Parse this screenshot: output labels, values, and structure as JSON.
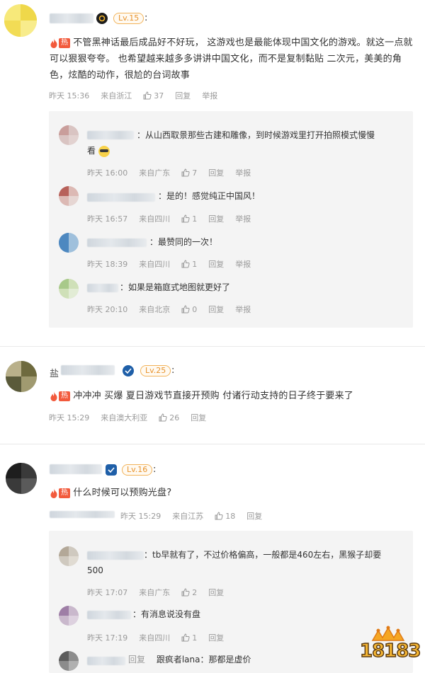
{
  "comments": [
    {
      "level": "Lv.15",
      "hot_tag": "热",
      "text_line1": "不管黑神话最后成品好不好玩， 这游戏也是最能体现中国文化的游戏。就这一点就",
      "text_line2": "可以狠狠夸夸。 也希望越来越多多讲讲中国文化，而不是复制黏贴 二次元，美美的角",
      "text_line3": "色，炫酷的动作，很尬的台词故事",
      "time": "昨天 15:36",
      "location": "来自浙江",
      "likes": "37",
      "reply_label": "回复",
      "report_label": "举报",
      "replies": [
        {
          "text_line1": "：从山西取景那些古建和雕像，到时候游戏里打开拍照模式慢慢",
          "text_line2": "看",
          "time": "昨天 16:00",
          "location": "来自广东",
          "likes": "7",
          "reply_label": "回复",
          "report_label": "举报"
        },
        {
          "text_line1": "：是的！感觉纯正中国风！",
          "time": "昨天 16:57",
          "location": "来自四川",
          "likes": "1",
          "reply_label": "回复",
          "report_label": "举报"
        },
        {
          "text_line1": "：最赞同的一次！",
          "time": "昨天 18:39",
          "location": "来自四川",
          "likes": "1",
          "reply_label": "回复",
          "report_label": "举报"
        },
        {
          "text_line1": "：如果是箱庭式地图就更好了",
          "time": "昨天 20:10",
          "location": "来自北京",
          "likes": "0",
          "reply_label": "回复",
          "report_label": "举报"
        }
      ]
    },
    {
      "name_prefix": "盐",
      "level": "Lv.25",
      "hot_tag": "热",
      "text_line1": "冲冲冲 买爆 夏日游戏节直接开预购 付诸行动支持的日子终于要来了",
      "time": "昨天 15:29",
      "location": "来自澳大利亚",
      "likes": "26",
      "reply_label": "回复"
    },
    {
      "level": "Lv.16",
      "hot_tag": "热",
      "text_line1": "什么时候可以预购光盘?",
      "time": "昨天 15:29",
      "location": "来自江苏",
      "likes": "18",
      "reply_label": "回复",
      "replies": [
        {
          "text_line1": "：tb早就有了，不过价格偏高，一般都是460左右，黑猴子却要",
          "text_line2": "500",
          "time": "昨天 17:07",
          "location": "来自广东",
          "likes": "2",
          "reply_label": "回复"
        },
        {
          "text_line1": "：有消息说没有盘",
          "time": "昨天 17:19",
          "location": "来自四川",
          "likes": "1",
          "reply_label": "回复"
        },
        {
          "reply_prefix": "回复",
          "reply_to": "跟疯者lana",
          "text_line1": "：那都是虚价"
        }
      ]
    }
  ],
  "watermark": {
    "text": "18183"
  },
  "colors": {
    "hot": "#f25a3c",
    "level_border": "#f2b35a",
    "level_text": "#e8932c",
    "meta": "#9a9a9a",
    "reply_bg": "#f4f4f4"
  }
}
